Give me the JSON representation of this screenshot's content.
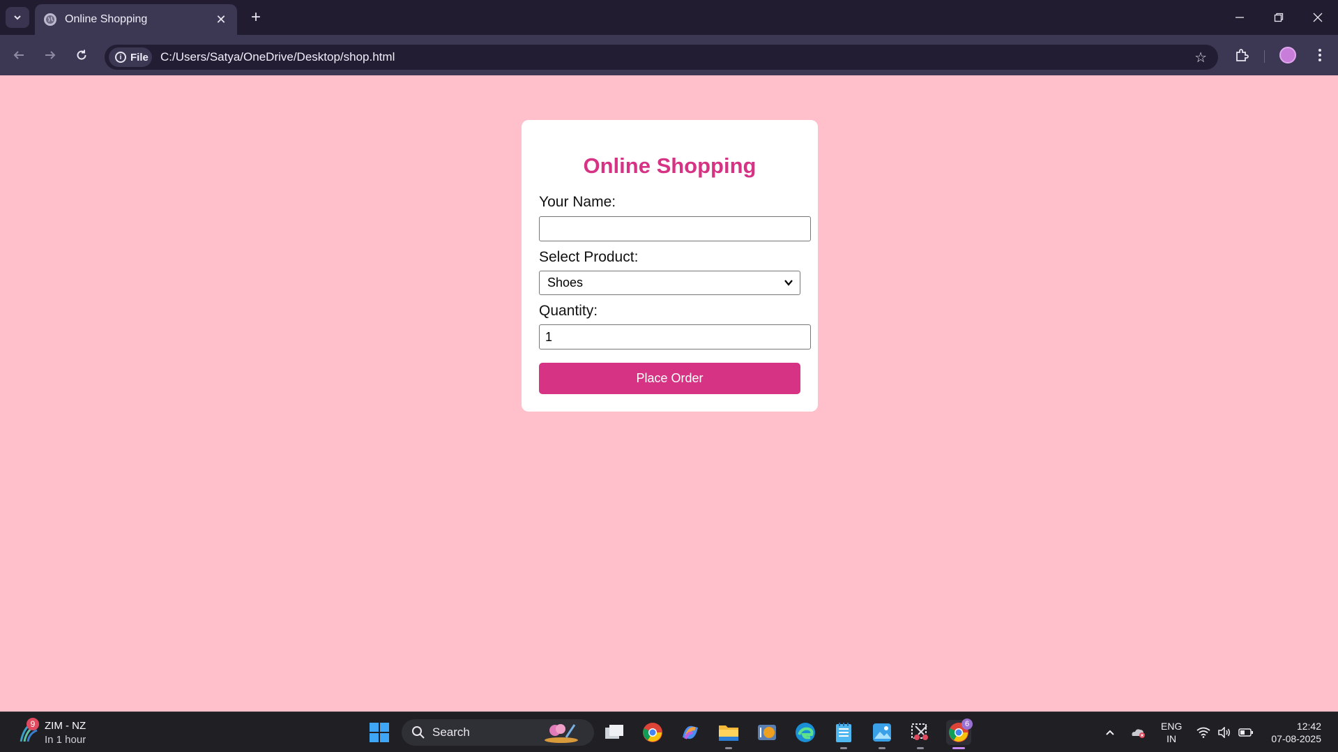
{
  "browser": {
    "tab_title": "Online Shopping",
    "site_chip": "File",
    "url": "C:/Users/Satya/OneDrive/Desktop/shop.html"
  },
  "page": {
    "title": "Online Shopping",
    "name_label": "Your Name:",
    "name_value": "",
    "product_label": "Select Product:",
    "product_selected": "Shoes",
    "quantity_label": "Quantity:",
    "quantity_value": "1",
    "submit_label": "Place Order",
    "colors": {
      "background": "#ffc0cb",
      "accent": "#d63384",
      "card": "#ffffff"
    }
  },
  "taskbar": {
    "weather_badge": "9",
    "weather_title": "ZIM - NZ",
    "weather_sub": "In 1 hour",
    "search_label": "Search",
    "lang_line1": "ENG",
    "lang_line2": "IN",
    "time": "12:42",
    "date": "07-08-2025",
    "chrome_badge": "6",
    "pinned_icons": [
      "windows-start-icon",
      "task-view-icon",
      "chrome-icon",
      "copilot-icon",
      "file-explorer-icon",
      "media-player-icon",
      "edge-icon",
      "notepad-icon",
      "photos-icon",
      "snipping-tool-icon",
      "chrome-active-icon"
    ]
  }
}
